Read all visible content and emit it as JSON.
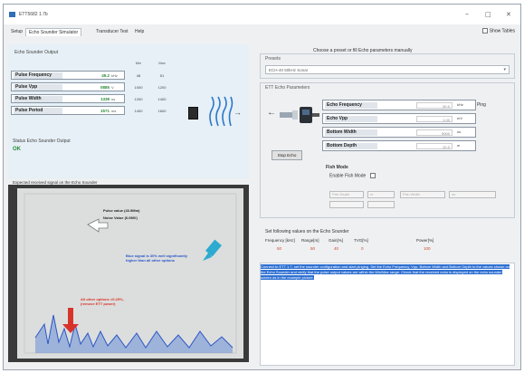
{
  "window": {
    "title": "ETT5682 1.7b",
    "minimize": "–",
    "maximize": "□",
    "close": "✕"
  },
  "tabs": [
    {
      "label": "Setup"
    },
    {
      "label": "Echo Sounder Simulator"
    },
    {
      "label": "Transducer Test"
    },
    {
      "label": "Help"
    }
  ],
  "show_tables_label": "Show Tables",
  "output": {
    "section_title": "Echo Sounder Output",
    "col_min": "Min",
    "col_max": "Max",
    "rows": [
      {
        "name": "Pulse Frequency",
        "value": "49.2",
        "unit": "kHz",
        "min": "48",
        "max": "51"
      },
      {
        "name": "Pulse Vpp",
        "value": "0885",
        "unit": "V",
        "min": "1000",
        "max": "1200"
      },
      {
        "name": "Pulse Width",
        "value": "1338",
        "unit": "us",
        "min": "1200",
        "max": "1400"
      },
      {
        "name": "Pulse Period",
        "value": "1571",
        "unit": "ms",
        "min": "1400",
        "max": "1600"
      }
    ],
    "status_label": "Status Echo Sounder Output",
    "status_value": "OK"
  },
  "photo": {
    "caption": "Expected received signal on the Echo Sounder",
    "annotation_pulse": "Pulse value (43.9Mm)",
    "annotation_noise": "Noise Value (6.0MV)",
    "annotation_blue": "Blue signal is 30% well significantly higher than all other options",
    "annotation_red": "All other options <0.25%, (remove ETT power)"
  },
  "presets": {
    "choose_label": "Choose a preset or fill Echo parameters manually",
    "group_title": "Presets",
    "selected": "ECH-40 50kHz Sonar"
  },
  "params": {
    "group_title": "ETT Echo Parameters",
    "start_ping": "Start Ping",
    "rows": [
      {
        "name": "Echo Frequency",
        "value": "50.0",
        "unit": "kHz"
      },
      {
        "name": "Echo Vpp",
        "value": "1.00",
        "unit": "mV"
      },
      {
        "name": "Bottom Width",
        "value": "5000",
        "unit": "us"
      },
      {
        "name": "Bottom Depth",
        "value": "20.0",
        "unit": "m"
      }
    ],
    "stop_button": "Stop Echo",
    "fish_title": "Fish Mode",
    "fish_enable": "Enable Fish Mode",
    "fish_depth_label": "Fish Depth",
    "fish_width_label": "Fish Width",
    "fish_unit_m": "m",
    "fish_unit_us": "us"
  },
  "settings": {
    "label": "Set following values on the Echo Sounder",
    "headers": [
      "Frequency [kHz]",
      "Range[m]",
      "Gain[%]",
      "TVG[%]",
      "Power[%]"
    ],
    "values": [
      "50",
      "50",
      "40",
      "0",
      "100"
    ]
  },
  "log": {
    "text": "Connect to ETT 1.7, set the sounder configuration and start pinging. Set the Echo Frequency, Vpp, Bottom Width and Bottom Depth to the values shown on the Echo Sounder and verify that the pulse output values are within the Min/Max range. Check that the received echo is displayed on the echo sounder screen as in the example picture."
  },
  "colors": {
    "ok_green": "#2a8a3a",
    "highlight_blue": "#2d6fd2",
    "annotation_red": "#d8332a",
    "annotation_blue": "#2b56c9"
  }
}
